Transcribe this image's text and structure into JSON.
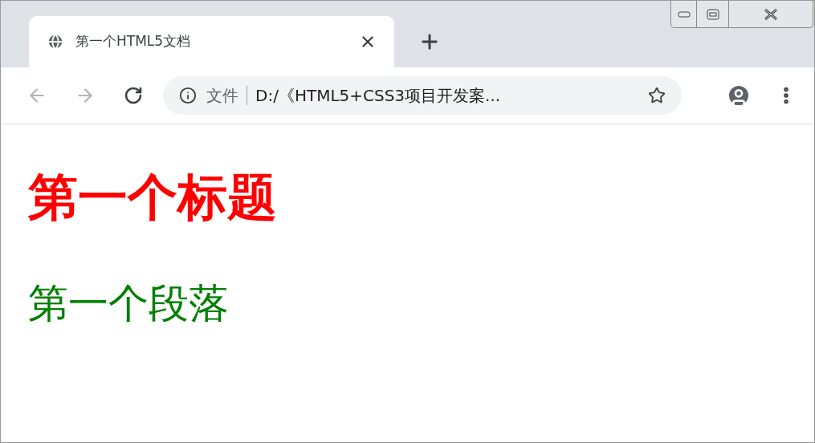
{
  "tab": {
    "title": "第一个HTML5文档",
    "selected": true
  },
  "nav_buttons": [
    {
      "kind": "back",
      "disabled": true
    },
    {
      "kind": "forward",
      "disabled": true
    },
    {
      "kind": "reload",
      "disabled": false
    }
  ],
  "address_bar": {
    "scheme_label": "文件",
    "url": "D:/《HTML5+CSS3项目开发案..."
  },
  "page": {
    "heading": "第一个标题",
    "paragraph": "第一个段落"
  }
}
